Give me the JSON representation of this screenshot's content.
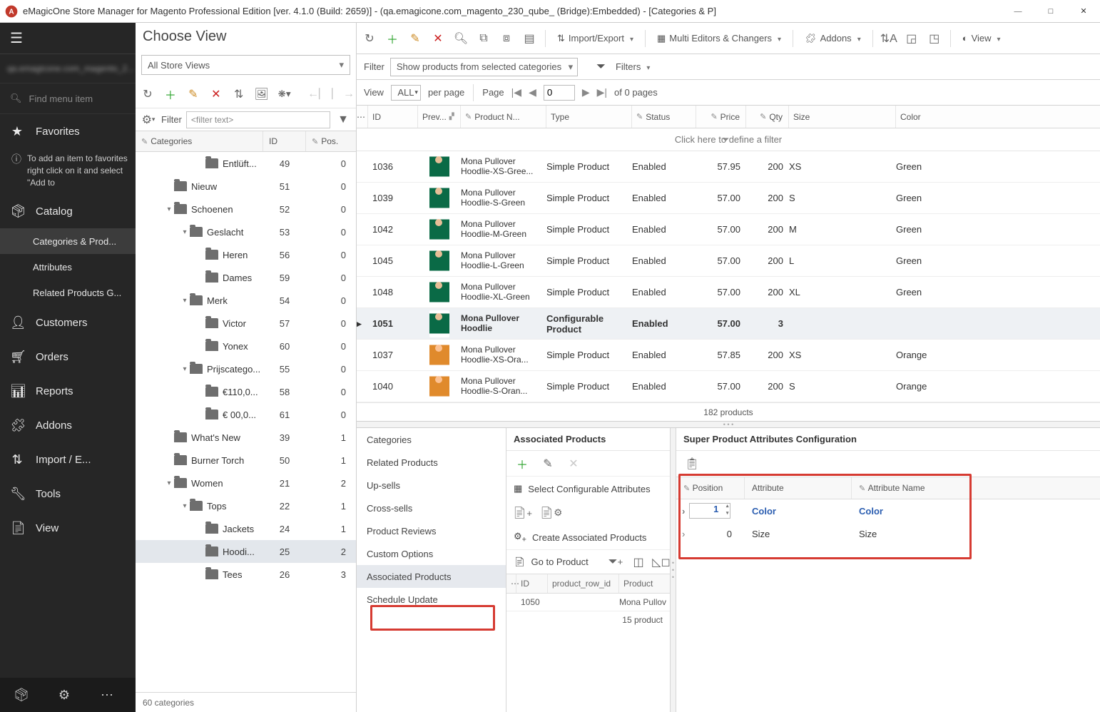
{
  "window": {
    "title": "eMagicOne Store Manager for Magento Professional Edition [ver. 4.1.0 (Build: 2659)] - (qa.emagicone.com_magento_230_qube_ (Bridge):Embedded) - [Categories & P]"
  },
  "nav": {
    "search_placeholder": "Find menu item",
    "favorites": "Favorites",
    "fav_hint": "To add an item to favorites right click on it and select \"Add to",
    "catalog": "Catalog",
    "catalog_children": {
      "cp": "Categories & Prod...",
      "attr": "Attributes",
      "rpg": "Related Products G..."
    },
    "customers": "Customers",
    "orders": "Orders",
    "reports": "Reports",
    "addons": "Addons",
    "import": "Import / E...",
    "tools": "Tools",
    "view": "View"
  },
  "catpane": {
    "heading": "Choose View",
    "store": "All Store Views",
    "filter_label": "Filter",
    "filter_placeholder": "<filter text>",
    "head": {
      "c1": "Categories",
      "c2": "ID",
      "c3": "Pos."
    },
    "rows": [
      {
        "depth": 4,
        "ex": "",
        "name": "Entlüft...",
        "id": "49",
        "pos": "0"
      },
      {
        "depth": 2,
        "ex": "",
        "name": "Nieuw",
        "id": "51",
        "pos": "0"
      },
      {
        "depth": 2,
        "ex": "▾",
        "name": "Schoenen",
        "id": "52",
        "pos": "0"
      },
      {
        "depth": 3,
        "ex": "▾",
        "name": "Geslacht",
        "id": "53",
        "pos": "0"
      },
      {
        "depth": 4,
        "ex": "",
        "name": "Heren",
        "id": "56",
        "pos": "0"
      },
      {
        "depth": 4,
        "ex": "",
        "name": "Dames",
        "id": "59",
        "pos": "0"
      },
      {
        "depth": 3,
        "ex": "▾",
        "name": "Merk",
        "id": "54",
        "pos": "0"
      },
      {
        "depth": 4,
        "ex": "",
        "name": "Victor",
        "id": "57",
        "pos": "0"
      },
      {
        "depth": 4,
        "ex": "",
        "name": "Yonex",
        "id": "60",
        "pos": "0"
      },
      {
        "depth": 3,
        "ex": "▾",
        "name": "Prijscatego...",
        "id": "55",
        "pos": "0"
      },
      {
        "depth": 4,
        "ex": "",
        "name": "€110,0...",
        "id": "58",
        "pos": "0"
      },
      {
        "depth": 4,
        "ex": "",
        "name": "€ 00,0...",
        "id": "61",
        "pos": "0"
      },
      {
        "depth": 2,
        "ex": "",
        "name": "What's New",
        "id": "39",
        "pos": "1"
      },
      {
        "depth": 2,
        "ex": "",
        "name": "Burner Torch",
        "id": "50",
        "pos": "1"
      },
      {
        "depth": 2,
        "ex": "▾",
        "name": "Women",
        "id": "21",
        "pos": "2"
      },
      {
        "depth": 3,
        "ex": "▾",
        "name": "Tops",
        "id": "22",
        "pos": "1"
      },
      {
        "depth": 4,
        "ex": "",
        "name": "Jackets",
        "id": "24",
        "pos": "1"
      },
      {
        "depth": 4,
        "ex": "",
        "name": "Hoodi...",
        "id": "25",
        "pos": "2",
        "sel": true
      },
      {
        "depth": 4,
        "ex": "",
        "name": "Tees",
        "id": "26",
        "pos": "3"
      }
    ],
    "status": "60 categories"
  },
  "toolbar": {
    "import_export": "Import/Export",
    "multi": "Multi Editors & Changers",
    "addons": "Addons",
    "view": "View"
  },
  "filterbar": {
    "label": "Filter",
    "sel": "Show products from selected categories",
    "filters": "Filters"
  },
  "viewbar": {
    "view": "View",
    "all": "ALL",
    "perpage": "per page",
    "page": "Page",
    "pagev": "0",
    "ofpages": "of 0 pages"
  },
  "grid": {
    "head": {
      "id": "ID",
      "prev": "Prev...",
      "name": "Product N...",
      "type": "Type",
      "status": "Status",
      "price": "Price",
      "qty": "Qty",
      "size": "Size",
      "color": "Color"
    },
    "define": "Click here to define a filter",
    "rows": [
      {
        "id": "1036",
        "name1": "Mona Pullover",
        "name2": "Hoodlie-XS-Gree...",
        "type": "Simple Product",
        "status": "Enabled",
        "price": "57.95",
        "qty": "200",
        "size": "XS",
        "color": "Green",
        "th": "green"
      },
      {
        "id": "1039",
        "name1": "Mona Pullover",
        "name2": "Hoodlie-S-Green",
        "type": "Simple Product",
        "status": "Enabled",
        "price": "57.00",
        "qty": "200",
        "size": "S",
        "color": "Green",
        "th": "green"
      },
      {
        "id": "1042",
        "name1": "Mona Pullover",
        "name2": "Hoodlie-M-Green",
        "type": "Simple Product",
        "status": "Enabled",
        "price": "57.00",
        "qty": "200",
        "size": "M",
        "color": "Green",
        "th": "green"
      },
      {
        "id": "1045",
        "name1": "Mona Pullover",
        "name2": "Hoodlie-L-Green",
        "type": "Simple Product",
        "status": "Enabled",
        "price": "57.00",
        "qty": "200",
        "size": "L",
        "color": "Green",
        "th": "green"
      },
      {
        "id": "1048",
        "name1": "Mona Pullover",
        "name2": "Hoodlie-XL-Green",
        "type": "Simple Product",
        "status": "Enabled",
        "price": "57.00",
        "qty": "200",
        "size": "XL",
        "color": "Green",
        "th": "green"
      },
      {
        "id": "1051",
        "name1": "Mona Pullover",
        "name2": "Hoodlie",
        "type": "Configurable Product",
        "status": "Enabled",
        "price": "57.00",
        "qty": "3",
        "size": "",
        "color": "",
        "th": "green",
        "sel": true
      },
      {
        "id": "1037",
        "name1": "Mona Pullover",
        "name2": "Hoodlie-XS-Ora...",
        "type": "Simple Product",
        "status": "Enabled",
        "price": "57.85",
        "qty": "200",
        "size": "XS",
        "color": "Orange",
        "th": "orange"
      },
      {
        "id": "1040",
        "name1": "Mona Pullover",
        "name2": "Hoodlie-S-Oran...",
        "type": "Simple Product",
        "status": "Enabled",
        "price": "57.00",
        "qty": "200",
        "size": "S",
        "color": "Orange",
        "th": "orange"
      }
    ],
    "status": "182 products"
  },
  "bottom": {
    "list": [
      "Categories",
      "Related Products",
      "Up-sells",
      "Cross-sells",
      "Product Reviews",
      "Custom Options",
      "Associated Products",
      "Schedule Update"
    ],
    "sel_index": 6,
    "assoc": {
      "title": "Associated Products",
      "select_attrs": "Select Configurable Attributes",
      "create": "Create Associated Products",
      "goto": "Go to Product",
      "head": {
        "id": "ID",
        "rowid": "product_row_id",
        "prod": "Product"
      },
      "row_id": "1050",
      "row_prod": "Mona Pullov",
      "foot": "15 product"
    },
    "super": {
      "title": "Super Product Attributes Configuration",
      "head": {
        "pos": "Position",
        "attr": "Attribute",
        "name": "Attribute Name"
      },
      "rows": [
        {
          "pos": "1",
          "attr": "Color",
          "name": "Color",
          "blue": true,
          "editing": true
        },
        {
          "pos": "0",
          "attr": "Size",
          "name": "Size"
        }
      ]
    }
  }
}
